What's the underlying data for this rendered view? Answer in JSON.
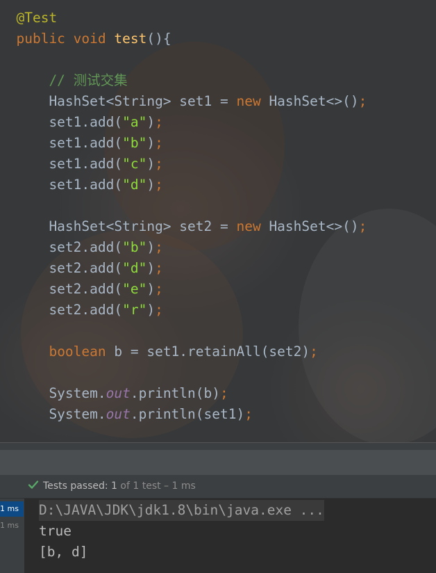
{
  "editor": {
    "lines": [
      {
        "segments": [
          {
            "t": "@Test",
            "c": "ann"
          }
        ]
      },
      {
        "segments": [
          {
            "t": "public void ",
            "c": "kw"
          },
          {
            "t": "test",
            "c": "fn"
          },
          {
            "t": "(){",
            "c": "plain"
          }
        ]
      },
      {
        "segments": []
      },
      {
        "segments": [
          {
            "t": "    // 测试交集",
            "c": "cm"
          }
        ]
      },
      {
        "segments": [
          {
            "t": "    HashSet<String> set1 = ",
            "c": "plain"
          },
          {
            "t": "new ",
            "c": "kw"
          },
          {
            "t": "HashSet<>()",
            "c": "plain"
          },
          {
            "t": ";",
            "c": "punct"
          }
        ]
      },
      {
        "segments": [
          {
            "t": "    set1.add(",
            "c": "plain"
          },
          {
            "t": "\"a\"",
            "c": "str-g"
          },
          {
            "t": ")",
            "c": "plain"
          },
          {
            "t": ";",
            "c": "punct"
          }
        ]
      },
      {
        "segments": [
          {
            "t": "    set1.add(",
            "c": "plain"
          },
          {
            "t": "\"b\"",
            "c": "str-g"
          },
          {
            "t": ")",
            "c": "plain"
          },
          {
            "t": ";",
            "c": "punct"
          }
        ]
      },
      {
        "segments": [
          {
            "t": "    set1.add(",
            "c": "plain"
          },
          {
            "t": "\"c\"",
            "c": "str-g"
          },
          {
            "t": ")",
            "c": "plain"
          },
          {
            "t": ";",
            "c": "punct"
          }
        ]
      },
      {
        "segments": [
          {
            "t": "    set1.add(",
            "c": "plain"
          },
          {
            "t": "\"d\"",
            "c": "str-g"
          },
          {
            "t": ")",
            "c": "plain"
          },
          {
            "t": ";",
            "c": "punct"
          }
        ]
      },
      {
        "segments": []
      },
      {
        "segments": [
          {
            "t": "    HashSet<String> set2 = ",
            "c": "plain"
          },
          {
            "t": "new ",
            "c": "kw"
          },
          {
            "t": "HashSet<>()",
            "c": "plain"
          },
          {
            "t": ";",
            "c": "punct"
          }
        ]
      },
      {
        "segments": [
          {
            "t": "    set2.add(",
            "c": "plain"
          },
          {
            "t": "\"b\"",
            "c": "str-g"
          },
          {
            "t": ")",
            "c": "plain"
          },
          {
            "t": ";",
            "c": "punct"
          }
        ]
      },
      {
        "segments": [
          {
            "t": "    set2.add(",
            "c": "plain"
          },
          {
            "t": "\"d\"",
            "c": "str-g"
          },
          {
            "t": ")",
            "c": "plain"
          },
          {
            "t": ";",
            "c": "punct"
          }
        ]
      },
      {
        "segments": [
          {
            "t": "    set2.add(",
            "c": "plain"
          },
          {
            "t": "\"e\"",
            "c": "str-g"
          },
          {
            "t": ")",
            "c": "plain"
          },
          {
            "t": ";",
            "c": "punct"
          }
        ]
      },
      {
        "segments": [
          {
            "t": "    set2.add(",
            "c": "plain"
          },
          {
            "t": "\"r\"",
            "c": "str-g"
          },
          {
            "t": ")",
            "c": "plain"
          },
          {
            "t": ";",
            "c": "punct"
          }
        ]
      },
      {
        "segments": []
      },
      {
        "segments": [
          {
            "t": "    ",
            "c": "plain"
          },
          {
            "t": "boolean ",
            "c": "kw"
          },
          {
            "t": "b = set1.retainAll(set2)",
            "c": "plain"
          },
          {
            "t": ";",
            "c": "punct"
          }
        ]
      },
      {
        "segments": []
      },
      {
        "segments": [
          {
            "t": "    System.",
            "c": "plain"
          },
          {
            "t": "out",
            "c": "fld"
          },
          {
            "t": ".println(b)",
            "c": "plain"
          },
          {
            "t": ";",
            "c": "punct"
          }
        ]
      },
      {
        "segments": [
          {
            "t": "    System.",
            "c": "plain"
          },
          {
            "t": "out",
            "c": "fld"
          },
          {
            "t": ".println(set1)",
            "c": "plain"
          },
          {
            "t": ";",
            "c": "punct"
          }
        ]
      }
    ],
    "indent_base": "  "
  },
  "run_panel": {
    "status_icon": "check-icon",
    "status_prefix": "Tests passed: ",
    "status_count": "1",
    "status_suffix": " of 1 test – 1 ms",
    "tree_times": [
      "1 ms",
      "1 ms"
    ]
  },
  "console": {
    "lines": [
      "D:\\JAVA\\JDK\\jdk1.8\\bin\\java.exe ...",
      "true",
      "[b, d]"
    ]
  },
  "colors": {
    "keyword": "#cc7832",
    "annotation": "#bbb529",
    "method": "#ffc66d",
    "comment": "#629755",
    "string": "#8fdc3c",
    "field": "#9876aa",
    "check": "#59a869",
    "selection": "#0d4a85"
  }
}
